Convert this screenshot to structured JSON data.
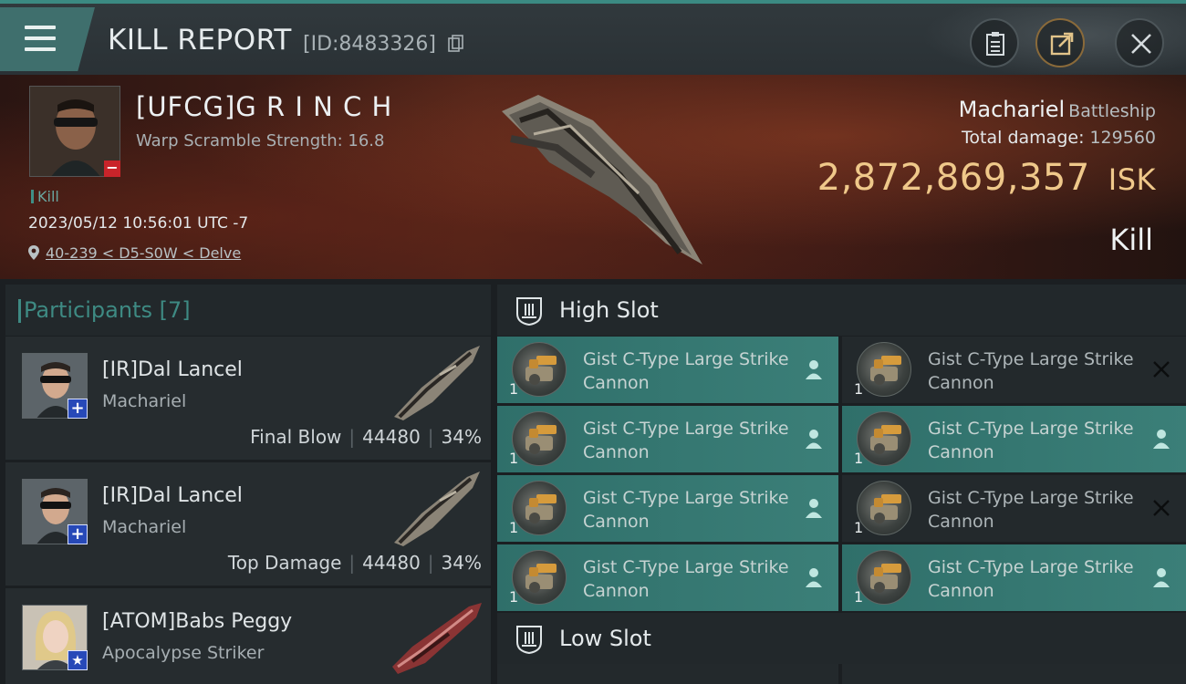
{
  "header": {
    "title": "KILL REPORT",
    "report_id": "[ID:8483326]"
  },
  "victim": {
    "name": "[UFCG]G R I N C H",
    "warp_scramble": "Warp Scramble Strength: 16.8",
    "kill_tag": "Kill",
    "datetime": "2023/05/12 10:56:01 UTC -7",
    "location": "40-239 < D5-S0W < Delve",
    "ship_name": "Machariel",
    "ship_class": "Battleship",
    "total_damage_label": "Total damage:",
    "total_damage": "129560",
    "isk_value": "2,872,869,357",
    "isk_unit": "ISK",
    "result": "Kill"
  },
  "participants": {
    "title": "Participants [7]",
    "items": [
      {
        "name": "[IR]Dal Lancel",
        "ship": "Machariel",
        "tag": "Final Blow",
        "damage": "44480",
        "percent": "34%"
      },
      {
        "name": "[IR]Dal Lancel",
        "ship": "Machariel",
        "tag": "Top Damage",
        "damage": "44480",
        "percent": "34%"
      },
      {
        "name": "[ATOM]Babs Peggy",
        "ship": "Apocalypse Striker"
      }
    ]
  },
  "slots": {
    "high": {
      "title": "High Slot",
      "modules": [
        {
          "name": "Gist C-Type Large Strike Cannon",
          "qty": "1",
          "state": "active"
        },
        {
          "name": "Gist C-Type Large Strike Cannon",
          "qty": "1",
          "state": "destroyed"
        },
        {
          "name": "Gist C-Type Large Strike Cannon",
          "qty": "1",
          "state": "active"
        },
        {
          "name": "Gist C-Type Large Strike Cannon",
          "qty": "1",
          "state": "active"
        },
        {
          "name": "Gist C-Type Large Strike Cannon",
          "qty": "1",
          "state": "active"
        },
        {
          "name": "Gist C-Type Large Strike Cannon",
          "qty": "1",
          "state": "destroyed"
        },
        {
          "name": "Gist C-Type Large Strike Cannon",
          "qty": "1",
          "state": "active"
        },
        {
          "name": "Gist C-Type Large Strike Cannon",
          "qty": "1",
          "state": "active"
        }
      ]
    },
    "low": {
      "title": "Low Slot"
    }
  },
  "colors": {
    "accent": "#3e8a83",
    "isk": "#efc88a",
    "active_module": "#3b7f78",
    "badge_blue": "#2749b8",
    "badge_red": "#c9242a"
  }
}
